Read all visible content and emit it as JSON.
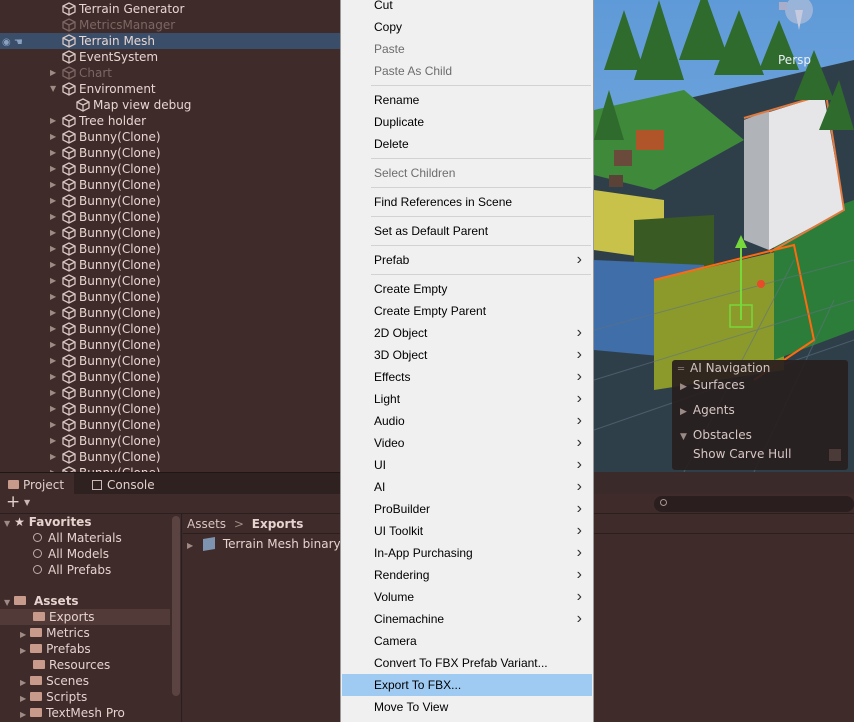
{
  "hierarchy": {
    "rows": [
      {
        "label": "Terrain Generator",
        "state": "normal"
      },
      {
        "label": "MetricsManager",
        "state": "dim"
      },
      {
        "label": "Terrain Mesh",
        "state": "selected"
      },
      {
        "label": "EventSystem",
        "state": "normal"
      },
      {
        "label": "Chart",
        "state": "dim"
      },
      {
        "label": "Environment",
        "state": "normal"
      },
      {
        "label": "Map view debug",
        "state": "normal"
      },
      {
        "label": "Tree holder",
        "state": "normal"
      },
      {
        "label": "Bunny(Clone)",
        "state": "normal"
      },
      {
        "label": "Bunny(Clone)",
        "state": "normal"
      },
      {
        "label": "Bunny(Clone)",
        "state": "normal"
      },
      {
        "label": "Bunny(Clone)",
        "state": "normal"
      },
      {
        "label": "Bunny(Clone)",
        "state": "normal"
      },
      {
        "label": "Bunny(Clone)",
        "state": "normal"
      },
      {
        "label": "Bunny(Clone)",
        "state": "normal"
      },
      {
        "label": "Bunny(Clone)",
        "state": "normal"
      },
      {
        "label": "Bunny(Clone)",
        "state": "normal"
      },
      {
        "label": "Bunny(Clone)",
        "state": "normal"
      },
      {
        "label": "Bunny(Clone)",
        "state": "normal"
      },
      {
        "label": "Bunny(Clone)",
        "state": "normal"
      },
      {
        "label": "Bunny(Clone)",
        "state": "normal"
      },
      {
        "label": "Bunny(Clone)",
        "state": "normal"
      },
      {
        "label": "Bunny(Clone)",
        "state": "normal"
      },
      {
        "label": "Bunny(Clone)",
        "state": "normal"
      },
      {
        "label": "Bunny(Clone)",
        "state": "normal"
      },
      {
        "label": "Bunny(Clone)",
        "state": "normal"
      },
      {
        "label": "Bunny(Clone)",
        "state": "normal"
      },
      {
        "label": "Bunny(Clone)",
        "state": "normal"
      },
      {
        "label": "Bunny(Clone)",
        "state": "normal"
      },
      {
        "label": "Bunny(Clone)",
        "state": "normal"
      },
      {
        "label": "Bunny(Clone)",
        "state": "normal"
      }
    ]
  },
  "scene": {
    "perspective_label": "Persp",
    "ai_navigation": {
      "title": "AI Navigation",
      "items": [
        "Surfaces",
        "Agents",
        "Obstacles"
      ],
      "option": "Show Carve Hull"
    }
  },
  "bottom": {
    "tabs": [
      "Project",
      "Console"
    ],
    "add_label": "+",
    "favorites": {
      "title": "Favorites",
      "items": [
        "All Materials",
        "All Models",
        "All Prefabs"
      ]
    },
    "assets": {
      "title": "Assets",
      "items": [
        "Exports",
        "Metrics",
        "Prefabs",
        "Resources",
        "Scenes",
        "Scripts",
        "TextMesh Pro"
      ]
    },
    "breadcrumb": [
      "Assets",
      "Exports"
    ],
    "files": [
      "Terrain Mesh binary"
    ]
  },
  "context_menu": {
    "items": [
      {
        "label": "Cut",
        "disabled": false,
        "submenu": false
      },
      {
        "label": "Copy",
        "disabled": false,
        "submenu": false
      },
      {
        "label": "Paste",
        "disabled": true,
        "submenu": false
      },
      {
        "label": "Paste As Child",
        "disabled": true,
        "submenu": false
      },
      {
        "sep": true
      },
      {
        "label": "Rename",
        "disabled": false,
        "submenu": false
      },
      {
        "label": "Duplicate",
        "disabled": false,
        "submenu": false
      },
      {
        "label": "Delete",
        "disabled": false,
        "submenu": false
      },
      {
        "sep": true
      },
      {
        "label": "Select Children",
        "disabled": true,
        "submenu": false
      },
      {
        "sep": true
      },
      {
        "label": "Find References in Scene",
        "disabled": false,
        "submenu": false
      },
      {
        "sep": true
      },
      {
        "label": "Set as Default Parent",
        "disabled": false,
        "submenu": false
      },
      {
        "sep": true
      },
      {
        "label": "Prefab",
        "disabled": false,
        "submenu": true
      },
      {
        "sep": true
      },
      {
        "label": "Create Empty",
        "disabled": false,
        "submenu": false
      },
      {
        "label": "Create Empty Parent",
        "disabled": false,
        "submenu": false
      },
      {
        "label": "2D Object",
        "disabled": false,
        "submenu": true
      },
      {
        "label": "3D Object",
        "disabled": false,
        "submenu": true
      },
      {
        "label": "Effects",
        "disabled": false,
        "submenu": true
      },
      {
        "label": "Light",
        "disabled": false,
        "submenu": true
      },
      {
        "label": "Audio",
        "disabled": false,
        "submenu": true
      },
      {
        "label": "Video",
        "disabled": false,
        "submenu": true
      },
      {
        "label": "UI",
        "disabled": false,
        "submenu": true
      },
      {
        "label": "AI",
        "disabled": false,
        "submenu": true
      },
      {
        "label": "ProBuilder",
        "disabled": false,
        "submenu": true
      },
      {
        "label": "UI Toolkit",
        "disabled": false,
        "submenu": true
      },
      {
        "label": "In-App Purchasing",
        "disabled": false,
        "submenu": true
      },
      {
        "label": "Rendering",
        "disabled": false,
        "submenu": true
      },
      {
        "label": "Volume",
        "disabled": false,
        "submenu": true
      },
      {
        "label": "Cinemachine",
        "disabled": false,
        "submenu": true
      },
      {
        "label": "Camera",
        "disabled": false,
        "submenu": false
      },
      {
        "label": "Convert To FBX Prefab Variant...",
        "disabled": false,
        "submenu": false
      },
      {
        "label": "Export To FBX...",
        "disabled": false,
        "submenu": false,
        "highlighted": true
      },
      {
        "label": "Move To View",
        "disabled": false,
        "submenu": false
      }
    ]
  }
}
